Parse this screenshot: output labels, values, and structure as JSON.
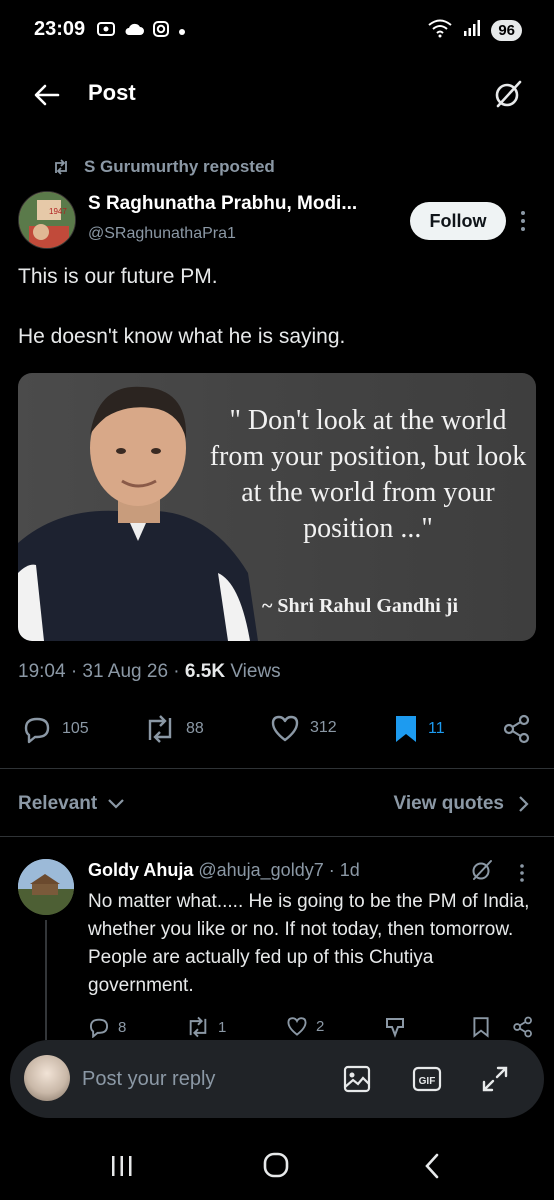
{
  "status_bar": {
    "time": "23:09",
    "battery": "96"
  },
  "header": {
    "title": "Post"
  },
  "repost": {
    "text": "S Gurumurthy reposted"
  },
  "post": {
    "author_name": "S Raghunatha Prabhu, Modi...",
    "author_handle": "@SRaghunathaPra1",
    "follow_label": "Follow",
    "text_line1": "This is our future PM.",
    "text_line2": "He doesn't know what he is saying.",
    "image": {
      "quote": "\" Don't look at the world from your position, but look at  the world from your position ...\"",
      "quote_author": "~ Shri Rahul Gandhi ji",
      "avatar_sign": "1947"
    },
    "meta_time": "19:04 · 31 Aug 26 · ",
    "meta_views_count": "6.5K",
    "meta_views_label": " Views",
    "stats": {
      "replies": "105",
      "reposts": "88",
      "likes": "312",
      "bookmarks": "11"
    }
  },
  "sort": {
    "relevant_label": "Relevant",
    "view_quotes_label": "View quotes"
  },
  "reply": {
    "name": "Goldy Ahuja",
    "handle_time": " @ahuja_goldy7 · 1d",
    "text": "No matter what..... He is going to be the PM of India, whether you like or no. If not today, then tomorrow. People are actually fed up of this Chutiya government.",
    "stats": {
      "replies": "8",
      "reposts": "1",
      "likes": "2"
    }
  },
  "composer": {
    "placeholder": "Post your reply",
    "gif_label": "GIF"
  },
  "colors": {
    "background": "#000000",
    "accent_blue": "#1d9bf0",
    "muted": "#8b98a5",
    "text": "#e7e9ea",
    "divider": "#2f3336"
  },
  "icons": [
    "back-arrow-icon",
    "grok-icon",
    "repost-icon",
    "reply-icon",
    "like-icon",
    "bookmark-icon",
    "share-icon",
    "image-icon",
    "gif-icon",
    "expand-icon"
  ]
}
